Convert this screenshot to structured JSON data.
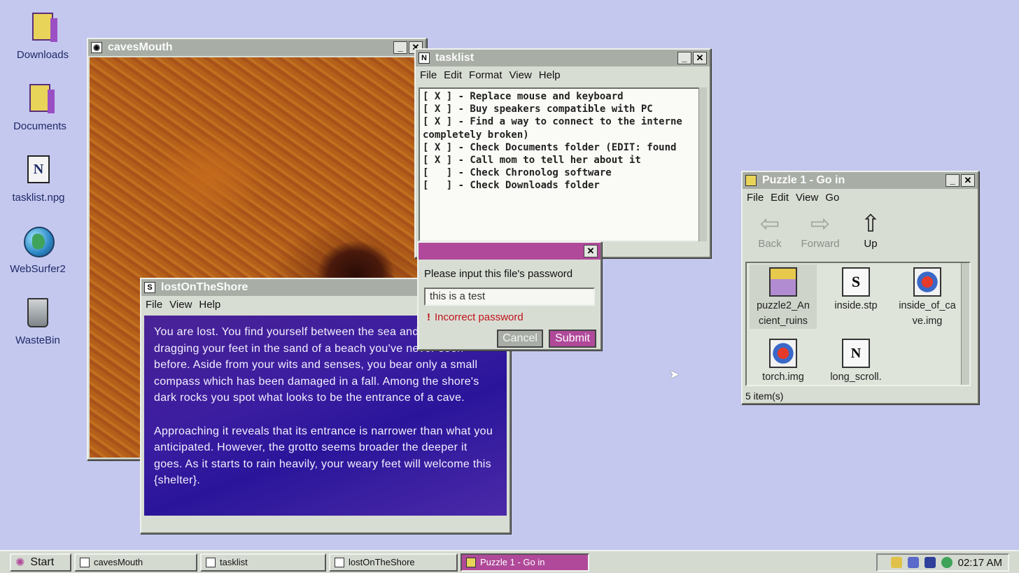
{
  "desktop_icons": [
    {
      "label": "Downloads"
    },
    {
      "label": "Documents"
    },
    {
      "label": "tasklist.npg"
    },
    {
      "label": "WebSurfer2"
    },
    {
      "label": "WasteBin"
    }
  ],
  "caves_window": {
    "title": "cavesMouth"
  },
  "tasklist_window": {
    "title": "tasklist",
    "menu": [
      "File",
      "Edit",
      "Format",
      "View",
      "Help"
    ],
    "content": "[ X ] - Replace mouse and keyboard\n[ X ] - Buy speakers compatible with PC\n[ X ] - Find a way to connect to the interne\ncompletely broken)\n[ X ] - Check Documents folder (EDIT: found\n[ X ] - Call mom to tell her about it\n[   ] - Check Chronolog software\n[   ] - Check Downloads folder"
  },
  "story_window": {
    "title": "lostOnTheShore",
    "menu": [
      "File",
      "View",
      "Help"
    ],
    "paragraph1": "You are lost. You find yourself between the sea and a forest, dragging your feet in the sand of a beach you've never seen before. Aside from your wits and senses, you bear only a small compass which has been damaged in a fall. Among the shore's dark rocks you spot what looks to be the entrance of a cave.",
    "paragraph2": "Approaching it reveals that its entrance is narrower than what you anticipated. However, the grotto seems broader the deeper it goes. As it starts to rain heavily, your weary feet will welcome this {shelter}."
  },
  "password_dialog": {
    "prompt": "Please input this file's password",
    "value": "this is a test",
    "error": "Incorrect password",
    "cancel_label": "Cancel",
    "submit_label": "Submit"
  },
  "puzzle_window": {
    "title": "Puzzle 1 - Go in",
    "menu": [
      "File",
      "Edit",
      "View",
      "Go"
    ],
    "nav": {
      "back": "Back",
      "forward": "Forward",
      "up": "Up"
    },
    "files": [
      {
        "name": "puzzle2_Ancient_ruins",
        "line1": "puzzle2_An",
        "line2": "cient_ruins",
        "icon": "zip-icon"
      },
      {
        "name": "inside.stp",
        "line1": "inside.stp",
        "line2": "",
        "icon": "stp-icon"
      },
      {
        "name": "inside_of_cave.img",
        "line1": "inside_of_ca",
        "line2": "ve.img",
        "icon": "image-icon"
      },
      {
        "name": "torch.img",
        "line1": "torch.img",
        "line2": "",
        "icon": "image-icon"
      },
      {
        "name": "long_scroll.",
        "line1": "long_scroll.",
        "line2": "",
        "icon": "note-icon"
      }
    ],
    "status": "5 item(s)"
  },
  "taskbar": {
    "start": "Start",
    "tasks": [
      "cavesMouth",
      "tasklist",
      "lostOnTheShore",
      "Puzzle 1 - Go in"
    ],
    "clock": "02:17 AM"
  },
  "colors": {
    "accent": "#b0499a",
    "desktop": "#c4c8ef",
    "error": "#c0141a"
  }
}
